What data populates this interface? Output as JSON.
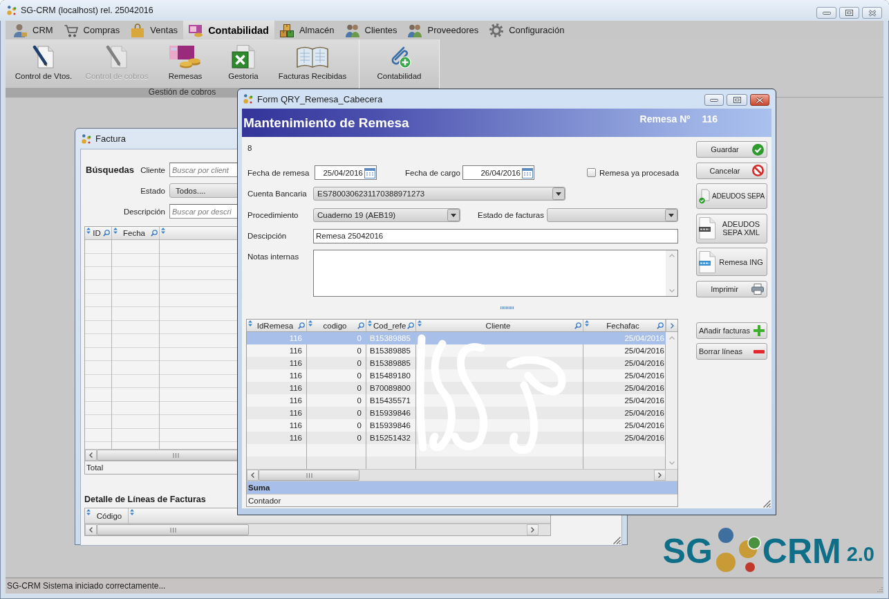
{
  "window": {
    "title": "SG-CRM (localhost) rel. 25042016"
  },
  "menu": [
    {
      "label": "CRM",
      "selected": false
    },
    {
      "label": "Compras",
      "selected": false
    },
    {
      "label": "Ventas",
      "selected": false
    },
    {
      "label": "Contabilidad",
      "selected": true
    },
    {
      "label": "Almacén",
      "selected": false
    },
    {
      "label": "Clientes",
      "selected": false
    },
    {
      "label": "Proveedores",
      "selected": false
    },
    {
      "label": "Configuración",
      "selected": false
    }
  ],
  "ribbon": {
    "groups": [
      {
        "label": "Gestión de cobros",
        "items": [
          {
            "label": "Control de Vtos.",
            "disabled": false
          },
          {
            "label": "Control de cobros",
            "disabled": true
          },
          {
            "label": "Remesas",
            "disabled": false
          },
          {
            "label": "Gestoria",
            "disabled": false
          },
          {
            "label": "Facturas Recibidas",
            "disabled": false
          }
        ]
      },
      {
        "items": [
          {
            "label": "Contabilidad",
            "disabled": false
          }
        ]
      }
    ]
  },
  "factura_window": {
    "title": "Factura",
    "search_title": "Búsquedas",
    "filters": [
      {
        "kind": "text",
        "label": "Cliente",
        "placeholder": "Buscar por client"
      },
      {
        "kind": "select",
        "label": "Estado",
        "value": "Todos...."
      },
      {
        "kind": "text",
        "label": "Descripción",
        "placeholder": "Buscar por descri"
      }
    ],
    "grid": {
      "columns": [
        "ID",
        "Fecha"
      ],
      "footer": "Total"
    },
    "detail": {
      "title": "Detalle de Líneas de Facturas",
      "columns": [
        "Código"
      ]
    }
  },
  "remesa_window": {
    "title": "Form QRY_Remesa_Cabecera",
    "heading": "Mantenimiento de Remesa",
    "number_label": "Remesa Nº",
    "number": "116",
    "record_count": "8",
    "fecha_remesa": {
      "label": "Fecha de remesa",
      "value": "25/04/2016"
    },
    "fecha_cargo": {
      "label": "Fecha de cargo",
      "value": "26/04/2016"
    },
    "procesada": {
      "label": "Remesa ya procesada",
      "checked": false
    },
    "cuenta_bancaria": {
      "label": "Cuenta Bancaria",
      "value": "ES7800306231170388971273"
    },
    "procedimiento": {
      "label": "Procedimiento",
      "value": "Cuaderno 19 (AEB19)"
    },
    "estado_facturas": {
      "label": "Estado de facturas"
    },
    "descripcion": {
      "label": "Descipción",
      "value": "Remesa 25042016"
    },
    "notas_internas": {
      "label": "Notas internas"
    },
    "grid": {
      "columns": [
        "IdRemesa",
        "codigo",
        "Cod_refe",
        "Cliente",
        "Fechafac"
      ],
      "rows": [
        {
          "idremesa": "116",
          "codigo": "0",
          "cod_refe": "B15389885",
          "fechafac": "25/04/2016",
          "selected": true
        },
        {
          "idremesa": "116",
          "codigo": "0",
          "cod_refe": "B15389885",
          "fechafac": "25/04/2016",
          "selected": false
        },
        {
          "idremesa": "116",
          "codigo": "0",
          "cod_refe": "B15389885",
          "fechafac": "25/04/2016",
          "selected": false
        },
        {
          "idremesa": "116",
          "codigo": "0",
          "cod_refe": "B15489180",
          "fechafac": "25/04/2016",
          "selected": false
        },
        {
          "idremesa": "116",
          "codigo": "0",
          "cod_refe": "B70089800",
          "fechafac": "25/04/2016",
          "selected": false
        },
        {
          "idremesa": "116",
          "codigo": "0",
          "cod_refe": "B15435571",
          "fechafac": "25/04/2016",
          "selected": false
        },
        {
          "idremesa": "116",
          "codigo": "0",
          "cod_refe": "B15939846",
          "fechafac": "25/04/2016",
          "selected": false
        },
        {
          "idremesa": "116",
          "codigo": "0",
          "cod_refe": "B15939846",
          "fechafac": "25/04/2016",
          "selected": false
        },
        {
          "idremesa": "116",
          "codigo": "0",
          "cod_refe": "B15251432",
          "fechafac": "25/04/2016",
          "selected": false
        }
      ],
      "footer": [
        {
          "label": "Suma",
          "highlighted": true
        },
        {
          "label": "Contador",
          "highlighted": false
        }
      ]
    },
    "buttons": [
      {
        "kind": "action",
        "label": "Guardar"
      },
      {
        "kind": "action",
        "label": "Cancelar"
      },
      {
        "kind": "export",
        "label": "ADEUDOS SEPA"
      },
      {
        "kind": "export",
        "label": "ADEUDOS SEPA XML"
      },
      {
        "kind": "export",
        "label": "Remesa ING"
      },
      {
        "kind": "action",
        "label": "Imprimir"
      }
    ],
    "grid_buttons": [
      {
        "label": "Añadir facturas"
      },
      {
        "label": "Borrar líneas"
      }
    ]
  },
  "logo": {
    "left": "SG",
    "right": "CRM",
    "version": "2.0"
  },
  "status_bar": {
    "text": "SG-CRM Sistema iniciado correctamente..."
  }
}
